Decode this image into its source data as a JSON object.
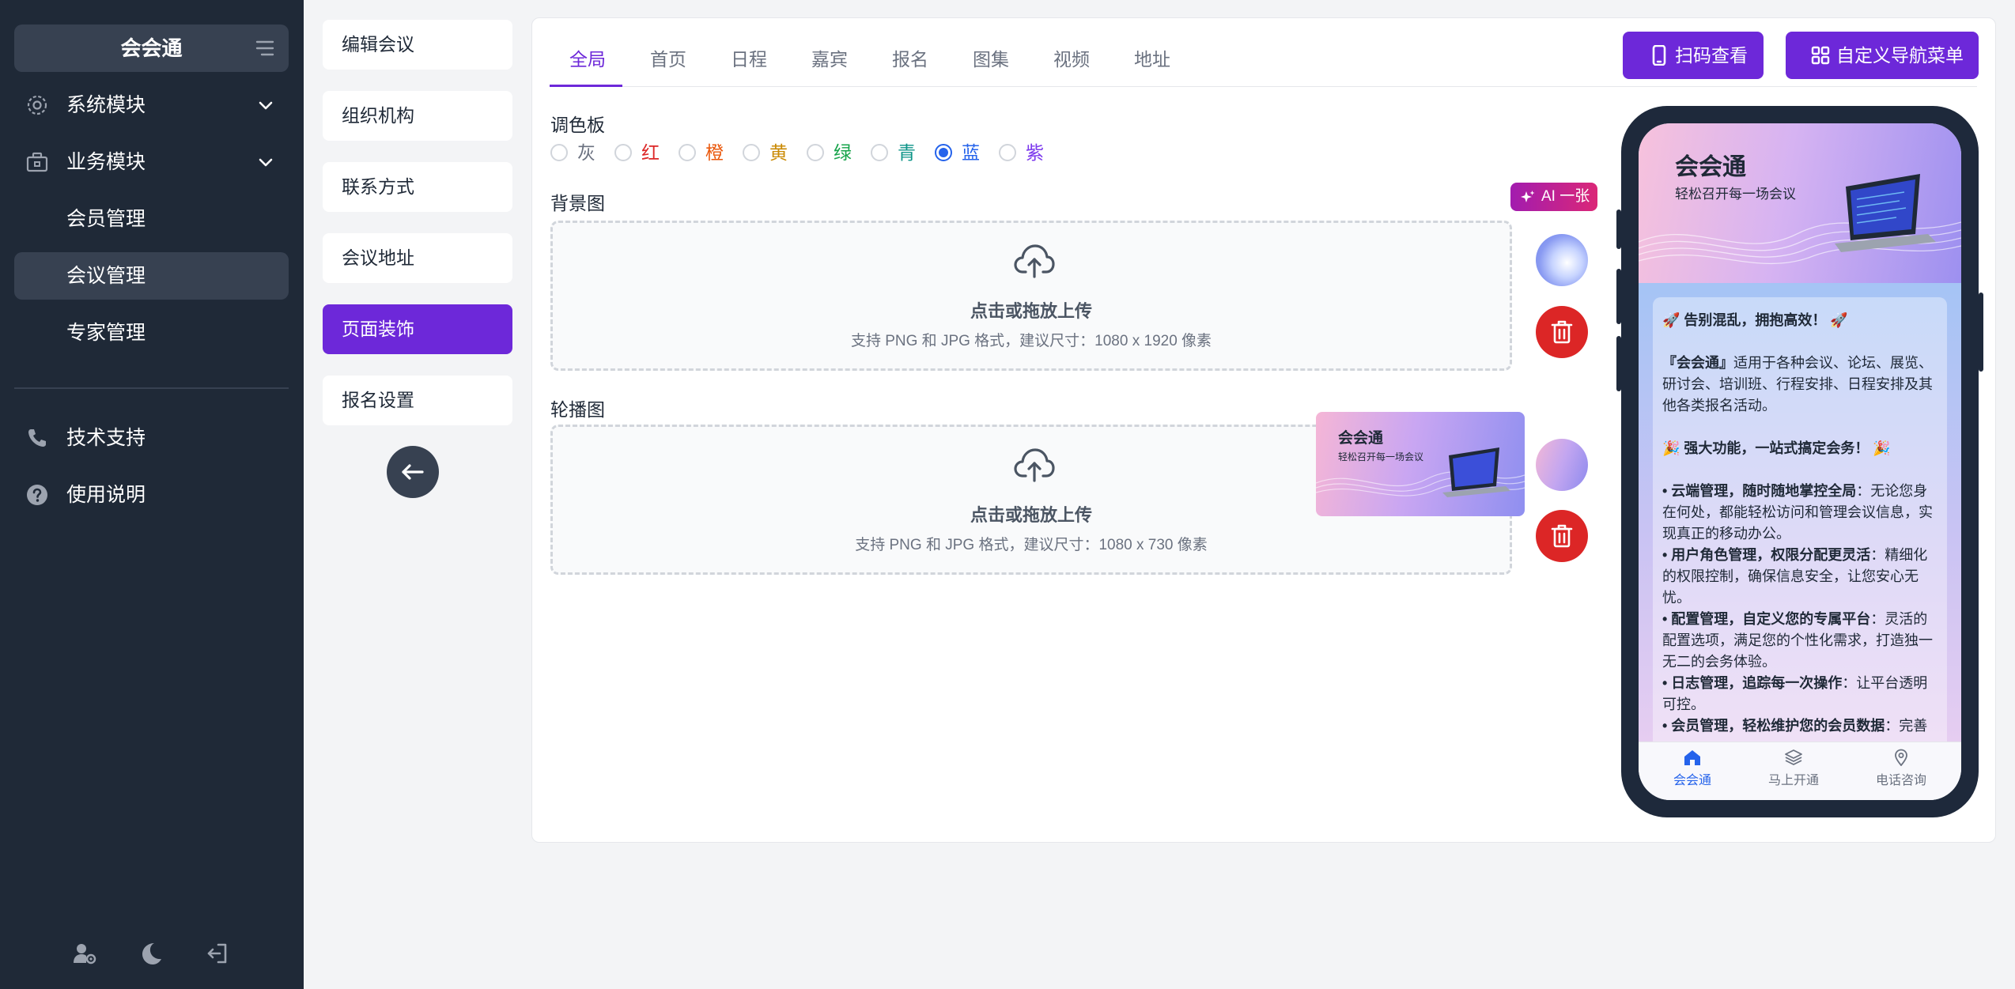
{
  "sidebar": {
    "brand": "会会通",
    "items": [
      {
        "label": "系统模块"
      },
      {
        "label": "业务模块"
      },
      {
        "label": "会员管理"
      },
      {
        "label": "会议管理"
      },
      {
        "label": "专家管理"
      },
      {
        "label": "技术支持"
      },
      {
        "label": "使用说明"
      }
    ]
  },
  "config_nav": {
    "items": [
      "编辑会议",
      "组织机构",
      "联系方式",
      "会议地址",
      "页面装饰",
      "报名设置"
    ],
    "active": "页面装饰"
  },
  "tabs": {
    "items": [
      "全局",
      "首页",
      "日程",
      "嘉宾",
      "报名",
      "图集",
      "视频",
      "地址"
    ],
    "active": "全局"
  },
  "actions": {
    "scan_label": "扫码查看",
    "menu_label": "自定义导航菜单"
  },
  "palette": {
    "title": "调色板",
    "options": [
      {
        "label": "灰",
        "color": "#6b7280"
      },
      {
        "label": "红",
        "color": "#dc2626"
      },
      {
        "label": "橙",
        "color": "#ea580c"
      },
      {
        "label": "黄",
        "color": "#ca8a04"
      },
      {
        "label": "绿",
        "color": "#16a34a"
      },
      {
        "label": "青",
        "color": "#0d9488"
      },
      {
        "label": "蓝",
        "color": "#2563eb"
      },
      {
        "label": "紫",
        "color": "#7c3aed"
      }
    ],
    "selected": "蓝"
  },
  "background": {
    "title": "背景图",
    "ai_label": "AI 一张",
    "upload_text": "点击或拖放上传",
    "upload_hint": "支持 PNG 和 JPG 格式，建议尺寸：1080 x 1920 像素"
  },
  "carousel": {
    "title": "轮播图",
    "upload_text": "点击或拖放上传",
    "upload_hint": "支持 PNG 和 JPG 格式，建议尺寸：1080 x 730 像素",
    "preview_title": "会会通",
    "preview_sub": "轻松召开每一场会议"
  },
  "phone": {
    "banner_title": "会会通",
    "banner_sub": "轻松召开每一场会议",
    "heading1": "🚀 告别混乱，拥抱高效！ 🚀",
    "intro_strong": "『会会通』",
    "intro_text": "适用于各种会议、论坛、展览、研讨会、培训班、行程安排、日程安排及其他各类报名活动。",
    "heading2": "🎉 强大功能，一站式搞定会务！ 🎉",
    "features": [
      {
        "strong": "• 云端管理，随时随地掌控全局",
        "text": "：无论您身在何处，都能轻松访问和管理会议信息，实现真正的移动办公。"
      },
      {
        "strong": "• 用户角色管理，权限分配更灵活",
        "text": "：精细化的权限控制，确保信息安全，让您安心无忧。"
      },
      {
        "strong": "• 配置管理，自定义您的专属平台",
        "text": "：灵活的配置选项，满足您的个性化需求，打造独一无二的会务体验。"
      },
      {
        "strong": "• 日志管理，追踪每一次操作",
        "text": "：让平台透明可控。"
      },
      {
        "strong": "• 会员管理，轻松维护您的会员数据",
        "text": "：完善"
      }
    ],
    "nav": [
      {
        "label": "会会通",
        "icon": "home-icon"
      },
      {
        "label": "马上开通",
        "icon": "layers-icon"
      },
      {
        "label": "电话咨询",
        "icon": "map-pin-icon"
      }
    ]
  }
}
